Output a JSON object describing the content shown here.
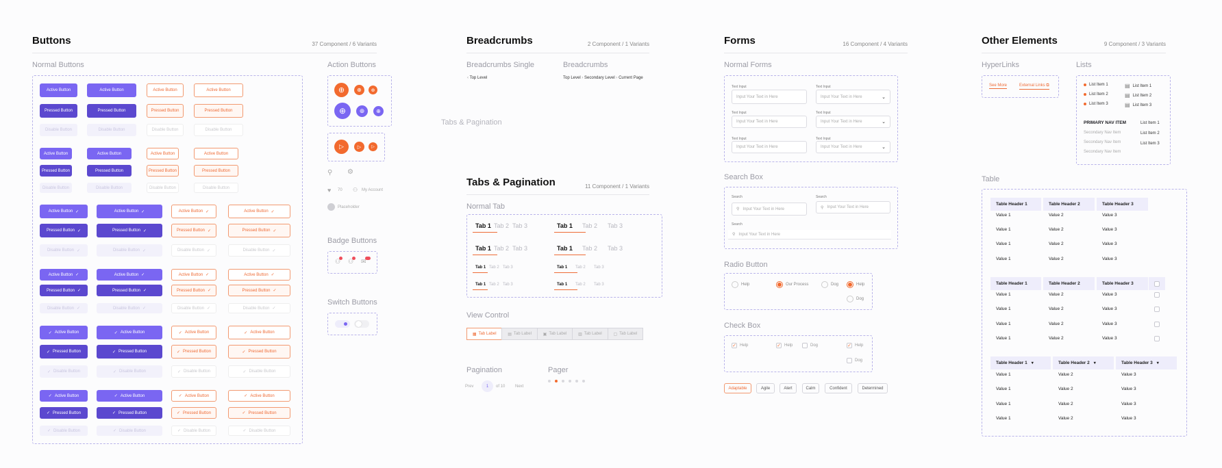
{
  "buttons": {
    "title": "Buttons",
    "meta": "37 Component / 6 Variants",
    "normal_title": "Normal Buttons",
    "active": "Active Button",
    "pressed": "Pressed Button",
    "disabled": "Disable Button",
    "action_title": "Action Buttons",
    "badge_title": "Badge Buttons",
    "switch_title": "Switch Buttons",
    "like_count": "70",
    "my_account": "My Account",
    "placeholder": "Placeholder"
  },
  "breadcrumbs": {
    "title": "Breadcrumbs",
    "meta": "2 Component / 1 Variants",
    "single_title": "Breadcrumbs Single",
    "single_item": "Top Level",
    "multi_title": "Breadcrumbs",
    "items": [
      "Top Level",
      "Secondary Level",
      "Current Page"
    ],
    "ghost": "Tabs & Pagination"
  },
  "tabs": {
    "title": "Tabs & Pagination",
    "meta": "11 Component / 1 Variants",
    "normal_title": "Normal Tab",
    "labels": [
      "Tab 1",
      "Tab 2",
      "Tab 3"
    ],
    "view_control_title": "View Control",
    "view_label": "Tab Label",
    "pagination_title": "Pagination",
    "pager_title": "Pager",
    "prev": "Prev",
    "page": "1",
    "of": "of 10",
    "next": "Next"
  },
  "forms": {
    "title": "Forms",
    "meta": "16 Component / 4 Variants",
    "normal_title": "Normal Forms",
    "input_label": "Text Input",
    "input_placeholder": "Input Your Text in Here",
    "search_title": "Search Box",
    "search_label": "Search",
    "search_placeholder": "Input Your Text in Here",
    "radio_title": "Radio Button",
    "check_title": "Check Box",
    "opts": {
      "help": "Help",
      "process": "Our Process",
      "dog": "Dog"
    },
    "tags": [
      "Adaptable",
      "Agile",
      "Alert",
      "Calm",
      "Confident",
      "Determined"
    ]
  },
  "other": {
    "title": "Other Elements",
    "meta": "9 Component / 3 Variants",
    "links_title": "HyperLinks",
    "see_more": "See More",
    "external": "External Links",
    "lists_title": "Lists",
    "list_items": [
      "List Item 1",
      "List Item 2",
      "List Item 3"
    ],
    "nav_primary": "PRIMARY NAV ITEM",
    "nav_secondary": "Secondary Nav Item",
    "table_title": "Table",
    "headers": [
      "Table Header 1",
      "Table Header 2",
      "Table Header 3"
    ],
    "values": [
      "Value 1",
      "Value 2",
      "Value 3"
    ]
  },
  "colors": {
    "accent": "#7a66f2",
    "accent_dark": "#5b48cf",
    "orange": "#f26a2e",
    "dash": "#b8b3ea"
  }
}
